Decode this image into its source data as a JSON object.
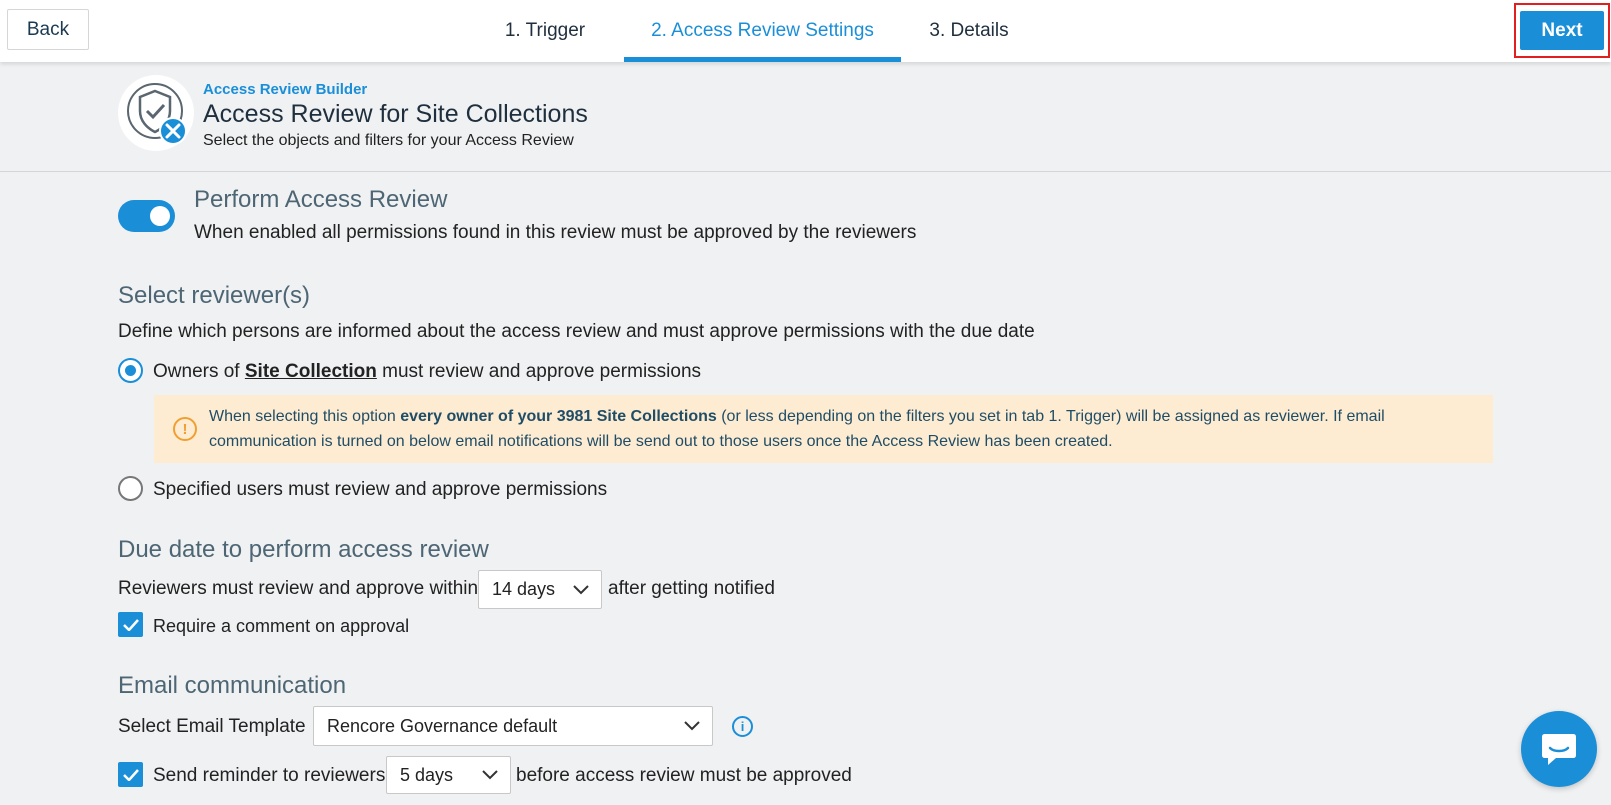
{
  "topbar": {
    "back_label": "Back",
    "next_label": "Next",
    "tabs": [
      {
        "label": "1. Trigger",
        "active": false
      },
      {
        "label": "2. Access Review Settings",
        "active": true
      },
      {
        "label": "3. Details",
        "active": false
      }
    ]
  },
  "header": {
    "eyebrow": "Access Review Builder",
    "title": "Access Review for Site Collections",
    "subtitle": "Select the objects and filters for your Access Review"
  },
  "perform": {
    "title": "Perform Access Review",
    "description": "When enabled all permissions found in this review must be approved by the reviewers",
    "enabled": true
  },
  "reviewers": {
    "title": "Select reviewer(s)",
    "description": "Define which persons are informed about the access review and must approve permissions with the due date",
    "option_owners_prefix": "Owners of ",
    "option_owners_link": "Site Collection",
    "option_owners_suffix": " must review and approve permissions",
    "warning_prefix": "When selecting this option ",
    "warning_bold": "every owner of your 3981 Site Collections",
    "warning_suffix": " (or less depending on the filters you set in tab 1. Trigger) will be assigned as reviewer. If email communication is turned on below email notifications will be send out to those users once the Access Review has been created.",
    "option_specified": "Specified users must review and approve permissions"
  },
  "due_date": {
    "title": "Due date to perform access review",
    "prefix": "Reviewers must review and approve within",
    "value": "14 days",
    "suffix": "after getting notified",
    "require_comment_label": "Require a comment on approval",
    "require_comment_checked": true
  },
  "email": {
    "title": "Email communication",
    "template_label": "Select Email Template",
    "template_value": "Rencore Governance default",
    "reminder_label": "Send reminder to reviewers",
    "reminder_value": "5 days",
    "reminder_suffix": "before access review must be approved",
    "reminder_checked": true
  },
  "colors": {
    "accent": "#1a8fd8",
    "warning_bg": "#fdebd2",
    "warning_icon": "#f0a030",
    "section_title": "#4e6674"
  }
}
